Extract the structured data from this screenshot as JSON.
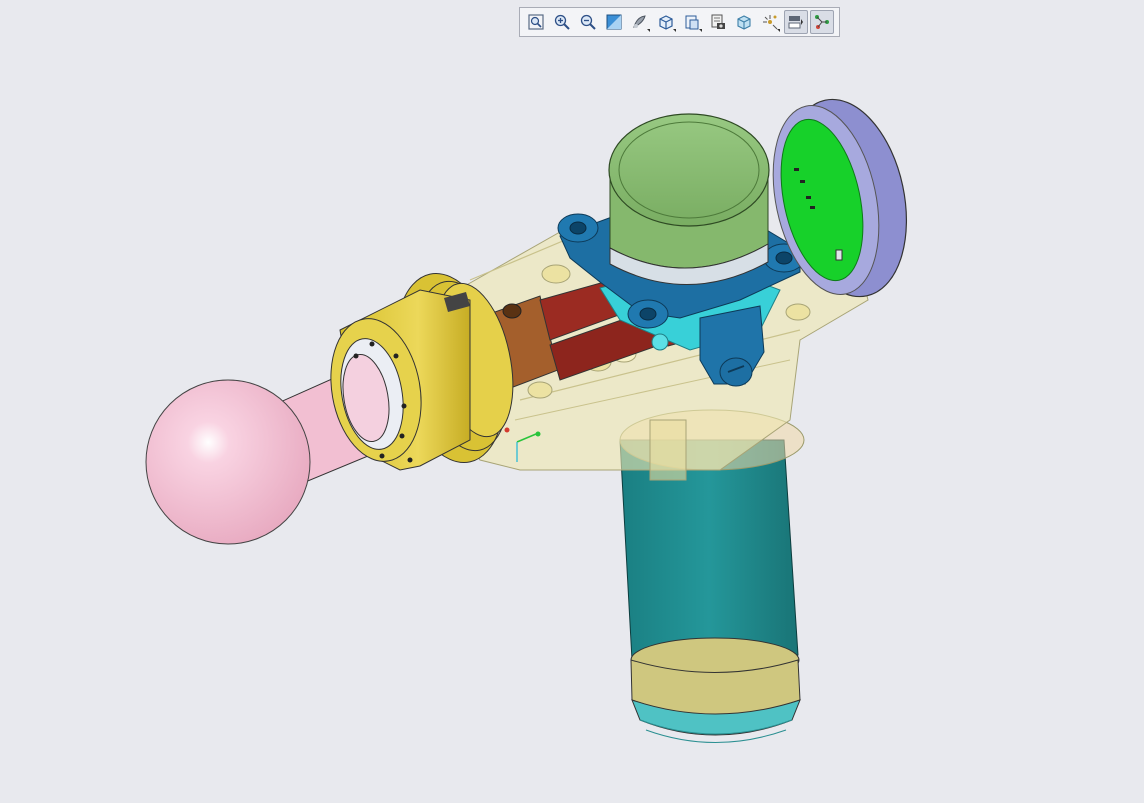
{
  "app": {
    "background": "#e8e9ee"
  },
  "toolbar": {
    "buttons": [
      {
        "name": "fit-all",
        "icon": "fit-all-icon",
        "active": false
      },
      {
        "name": "zoom-in",
        "icon": "zoom-in-icon",
        "active": false
      },
      {
        "name": "zoom-out",
        "icon": "zoom-out-icon",
        "active": false
      },
      {
        "name": "normal-view",
        "icon": "normal-view-icon",
        "active": false
      },
      {
        "name": "shading",
        "icon": "shading-icon",
        "active": false,
        "flyout": true
      },
      {
        "name": "iso-view",
        "icon": "iso-cube-icon",
        "active": false,
        "flyout": true
      },
      {
        "name": "multi-view",
        "icon": "multi-view-icon",
        "active": false,
        "flyout": true
      },
      {
        "name": "capture",
        "icon": "capture-icon",
        "active": false
      },
      {
        "name": "render-style",
        "icon": "render-style-icon",
        "active": false
      },
      {
        "name": "explode",
        "icon": "explode-icon",
        "active": false,
        "flyout": true
      },
      {
        "name": "hide-show",
        "icon": "hide-show-icon",
        "active": true
      },
      {
        "name": "swap-visible",
        "icon": "swap-visible-icon",
        "active": true
      }
    ]
  },
  "model": {
    "name": "massage-gun-assembly",
    "colors": {
      "head_ball": "#f4b8cf",
      "head_shaft": "#f2bfd2",
      "collar_gold": "#e2cd3c",
      "housing_translucent": "#efe7b0",
      "motor_cap": "#8cbf74",
      "motor_mount": "#1d6fa3",
      "rods": "#9b2b22",
      "coupler": "#a45f2c",
      "cyan_parts": "#38d0d8",
      "back_disc": "#8d8fd0",
      "pcb": "#17d12a",
      "handle": "#1f8a8c",
      "handle_band": "#cfc77f",
      "handle_base": "#4fc2c4"
    }
  }
}
